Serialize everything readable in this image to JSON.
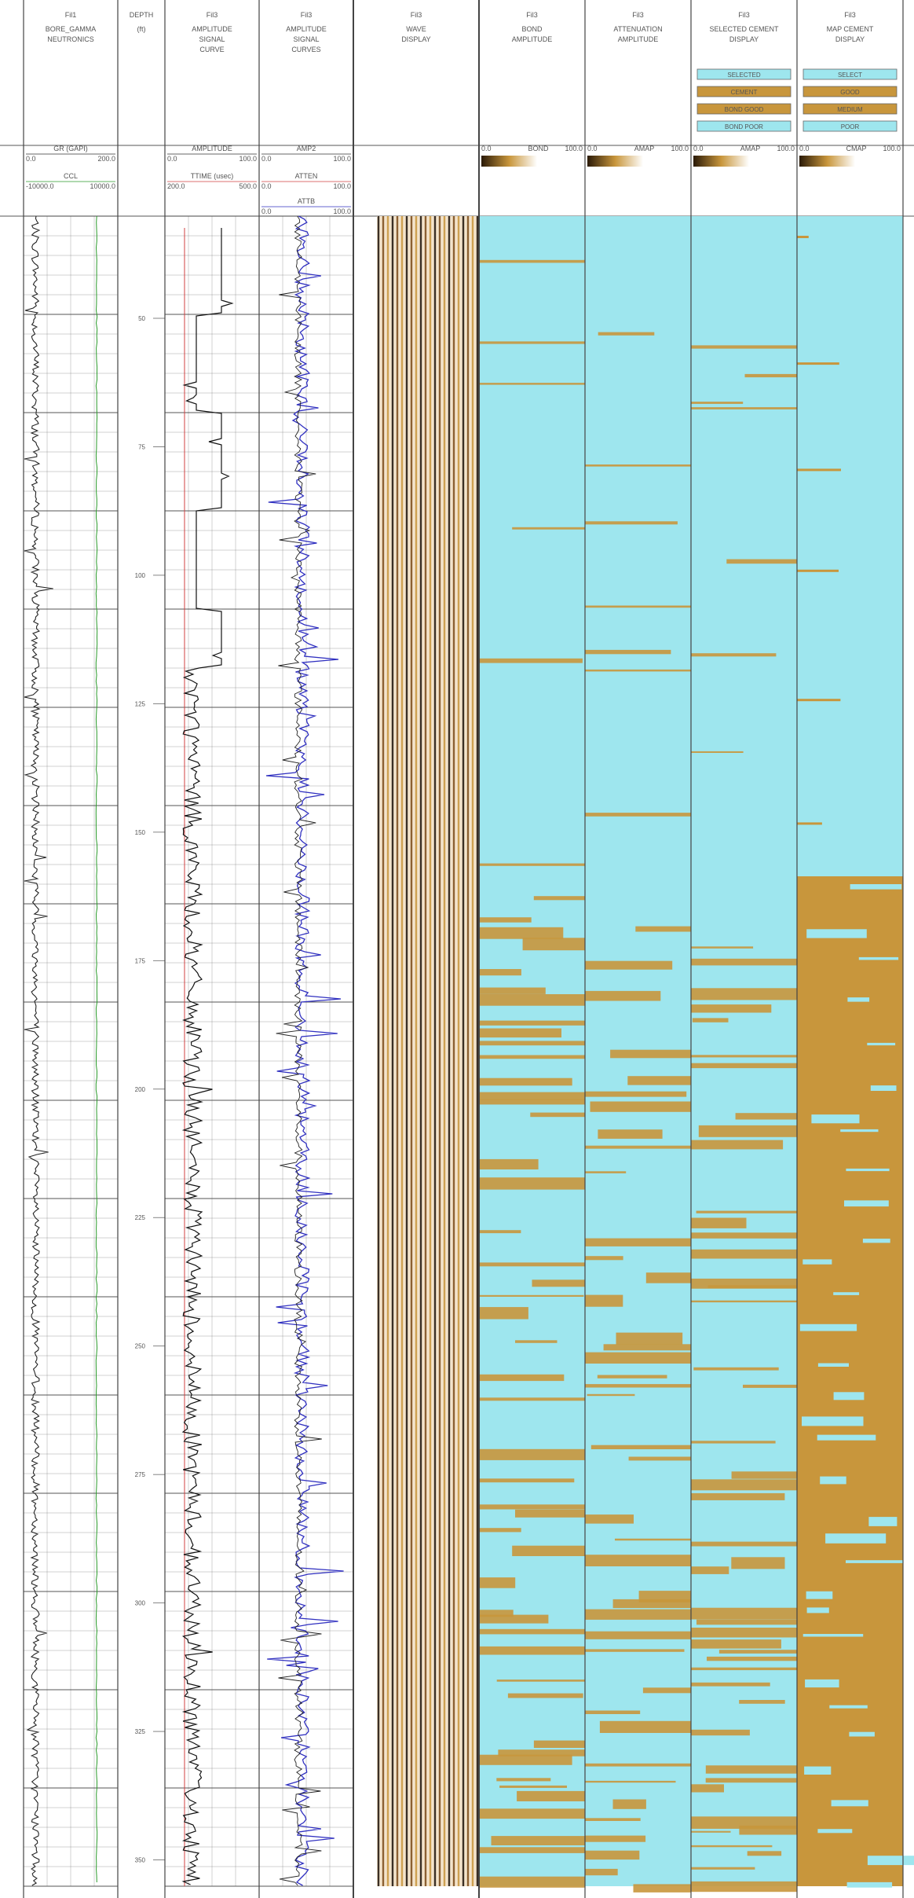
{
  "tracks": [
    {
      "id": "T1",
      "top": "Fil1",
      "lines": [
        "BORE_GAMMA",
        "NEUTRONICS"
      ]
    },
    {
      "id": "T2",
      "top": "DEPTH",
      "lines": [
        "(ft)"
      ]
    },
    {
      "id": "T3",
      "top": "Fil3",
      "lines": [
        "AMPLITUDE",
        "SIGNAL",
        "CURVE"
      ]
    },
    {
      "id": "T4",
      "top": "Fil3",
      "lines": [
        "AMPLITUDE",
        "SIGNAL",
        "CURVES"
      ]
    },
    {
      "id": "T5",
      "top": "Fil3",
      "lines": [
        "WAVE",
        "DISPLAY"
      ]
    },
    {
      "id": "T6",
      "top": "Fil3",
      "lines": [
        "BOND",
        "AMPLITUDE"
      ]
    },
    {
      "id": "T7",
      "top": "Fil3",
      "lines": [
        "ATTENUATION",
        "AMPLITUDE"
      ]
    },
    {
      "id": "T8",
      "top": "Fil3",
      "lines": [
        "SELECTED CEMENT",
        "DISPLAY"
      ]
    },
    {
      "id": "T9",
      "top": "Fil3",
      "lines": [
        "MAP CEMENT",
        "DISPLAY"
      ]
    }
  ],
  "legend_boxes": {
    "t8": [
      "SELECTED",
      "CEMENT",
      "BOND GOOD",
      "BOND POOR"
    ],
    "t9": [
      "SELECT",
      "GOOD",
      "MEDIUM",
      "POOR"
    ]
  },
  "curve_scales": {
    "gr": {
      "name": "GR (GAPI)",
      "min": "0.0",
      "max": "200.0"
    },
    "ccl": {
      "name": "CCL",
      "min": "-10000.0",
      "max": "10000.0"
    },
    "amp": {
      "name": "AMPLITUDE",
      "min": "0.0",
      "max": "100.0"
    },
    "ttime": {
      "name": "TTIME (usec)",
      "min": "200.0",
      "max": "500.0"
    },
    "amp2": {
      "name": "AMP2",
      "min": "0.0",
      "max": "100.0"
    },
    "atten": {
      "name": "ATTEN",
      "min": "0.0",
      "max": "100.0"
    },
    "attb": {
      "name": "ATTB",
      "min": "0.0",
      "max": "100.0"
    },
    "bond": {
      "name": "BOND",
      "min": "0.0",
      "max": "100.0"
    },
    "amap": {
      "name": "AMAP",
      "min": "0.0",
      "max": "100.0"
    },
    "amapsel": {
      "name": "AMAP",
      "min": "0.0",
      "max": "100.0"
    },
    "cmap": {
      "name": "CMAP",
      "min": "0.0",
      "max": "100.0"
    }
  },
  "depth_labels": [
    "50",
    "75",
    "100",
    "125",
    "150",
    "175",
    "200",
    "225",
    "250",
    "275",
    "300",
    "325",
    "350"
  ],
  "colors": {
    "cement_good": "#9ee6ee",
    "cement_poor": "#c8963c",
    "gr_curve": "#222222",
    "ccl_curve": "#2a9a2a",
    "ttime_curve": "#d04040",
    "atten_curve": "#3030c0",
    "grid": "#444444"
  }
}
